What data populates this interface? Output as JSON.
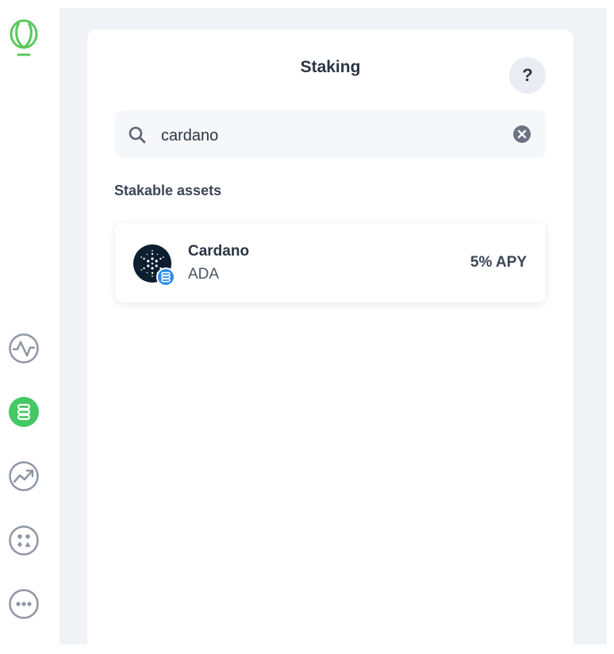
{
  "app": {
    "title": "Staking"
  },
  "sidebar": {
    "items": [
      {
        "icon": "activity-icon"
      },
      {
        "icon": "staking-icon",
        "active": true
      },
      {
        "icon": "trending-icon"
      },
      {
        "icon": "apps-icon"
      },
      {
        "icon": "more-icon"
      }
    ]
  },
  "header": {
    "title": "Staking",
    "help_label": "?"
  },
  "search": {
    "value": "cardano",
    "placeholder": ""
  },
  "section": {
    "label": "Stakable assets"
  },
  "assets": [
    {
      "name": "Cardano",
      "ticker": "ADA",
      "apy": "5% APY"
    }
  ],
  "colors": {
    "brand_green": "#5bc85b",
    "active_green": "#44c864",
    "nav_gray": "#8f96a3",
    "badge_blue": "#2f8de8",
    "cardano_navy": "#0d1e30"
  }
}
